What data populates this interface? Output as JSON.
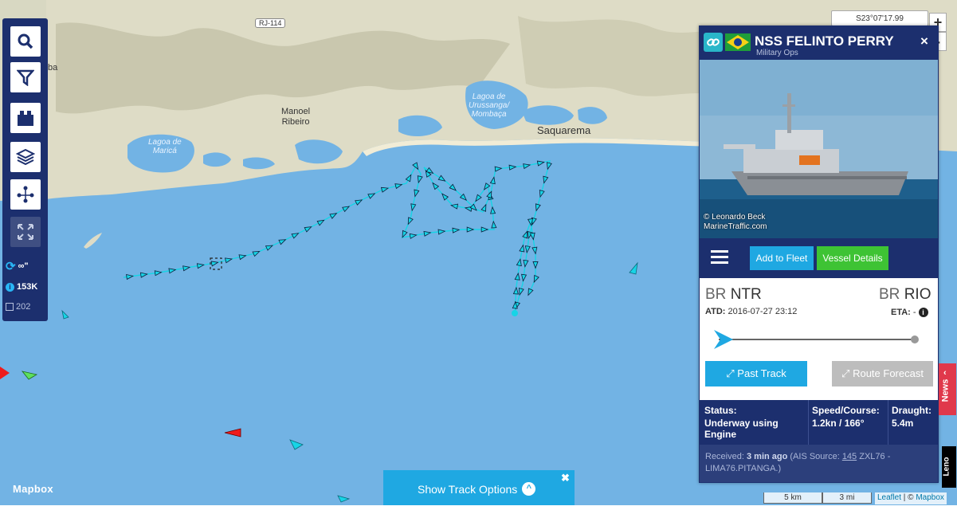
{
  "map": {
    "places": [
      {
        "name": "Manoel\nRibeiro",
        "lines": [
          "Manoel",
          "Ribeiro"
        ]
      },
      {
        "name": "Saquarema"
      },
      {
        "name": "ba"
      }
    ],
    "lagoons": {
      "marica": [
        "Lagoa de",
        "Maricá"
      ],
      "urussanga": [
        "Lagoa de",
        "Urussanga/",
        "Mombaça"
      ]
    },
    "road_label": "RJ-114",
    "coords": "S23°07'17.99",
    "zoom_in": "+",
    "zoom_out": "-",
    "mapbox_logo": "Mapbox",
    "scale_km": "5 km",
    "scale_mi": "3 mi",
    "attribution_leaflet": "Leaflet",
    "attribution_sep": " | © ",
    "attribution_mapbox": "Mapbox",
    "colors": {
      "sea": "#72b3e4",
      "land": "#dcdcc8",
      "track": "#17d4e6"
    }
  },
  "toolbar": {
    "buttons": [
      {
        "icon": "search-icon"
      },
      {
        "icon": "filter-icon"
      },
      {
        "icon": "fleet-icon"
      },
      {
        "icon": "layers-icon"
      },
      {
        "icon": "network-icon"
      },
      {
        "icon": "fullscreen-icon"
      }
    ],
    "refresh_label": "∞\"",
    "vessel_count": "153K",
    "selected_count": "202"
  },
  "panel": {
    "vessel_name": "NSS FELINTO PERRY",
    "vessel_type": "Military Ops",
    "close": "×",
    "photo_credit_1": "© Leonardo Beck",
    "photo_credit_2": "MarineTraffic.com",
    "add_to_fleet": "Add to Fleet",
    "vessel_details": "Vessel Details",
    "origin_country": "BR",
    "origin_port": "NTR",
    "dest_country": "BR",
    "dest_port": "RIO",
    "atd_label": "ATD:",
    "atd_value": "2016-07-27 23:12",
    "eta_label": "ETA:",
    "eta_value": "-",
    "past_track": "Past Track",
    "route_forecast": "Route Forecast",
    "status_label": "Status:",
    "status_value": "Underway using Engine",
    "speed_label": "Speed/Course:",
    "speed_value": "1.2kn / 166°",
    "draught_label": "Draught:",
    "draught_value": "5.4m",
    "received_label": "Received:",
    "received_value": "3 min ago",
    "ais_prefix": "(AIS Source:",
    "ais_id": "145",
    "ais_rest": "ZXL76 - LIMA76.PITANGA.)",
    "flag": "Brazil",
    "colors": {
      "navy": "#1c2f6e",
      "blue": "#1fa8e2",
      "green": "#3ec334",
      "grey": "#bdbdbd"
    }
  },
  "track_options": {
    "label": "Show Track Options",
    "close": "✖"
  },
  "news": "News",
  "ad": "Leno"
}
